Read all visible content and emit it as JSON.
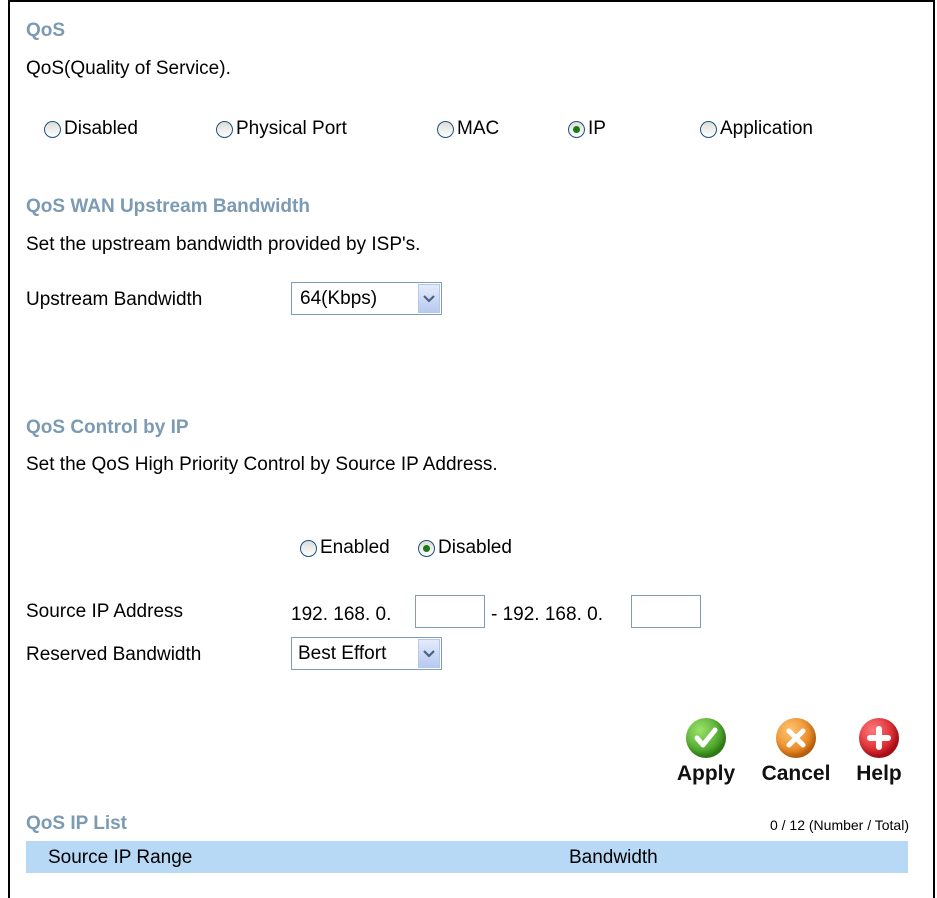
{
  "qos": {
    "title": "QoS",
    "description": "QoS(Quality of Service).",
    "modes": [
      {
        "label": "Disabled",
        "checked": false
      },
      {
        "label": "Physical Port",
        "checked": false
      },
      {
        "label": "MAC",
        "checked": false
      },
      {
        "label": "IP",
        "checked": true
      },
      {
        "label": "Application",
        "checked": false
      }
    ]
  },
  "upstream": {
    "title": "QoS WAN Upstream Bandwidth",
    "description": "Set the upstream bandwidth provided by ISP's.",
    "field_label": "Upstream Bandwidth",
    "selected": "64(Kbps)"
  },
  "control": {
    "title": "QoS Control by IP",
    "description": "Set the QoS High Priority Control by Source IP Address.",
    "enabled_label": "Enabled",
    "enabled_checked": false,
    "disabled_label": "Disabled",
    "disabled_checked": true,
    "source_ip_label": "Source IP Address",
    "ip_prefix_start": "192. 168. 0.",
    "ip_start_value": "",
    "ip_separator": "- 192. 168. 0.",
    "ip_end_value": "",
    "reserved_label": "Reserved Bandwidth",
    "reserved_selected": "Best Effort"
  },
  "buttons": {
    "apply": "Apply",
    "cancel": "Cancel",
    "help": "Help"
  },
  "list": {
    "title": "QoS IP List",
    "count": "0 / 12 (Number / Total)",
    "columns": [
      "Source IP Range",
      "Bandwidth"
    ]
  },
  "colors": {
    "heading": "#7b9ab3",
    "list_header_bg": "#b8d9f6",
    "apply_icon": "#3c9a1e",
    "cancel_icon": "#e87a12",
    "help_icon": "#d0141c"
  }
}
